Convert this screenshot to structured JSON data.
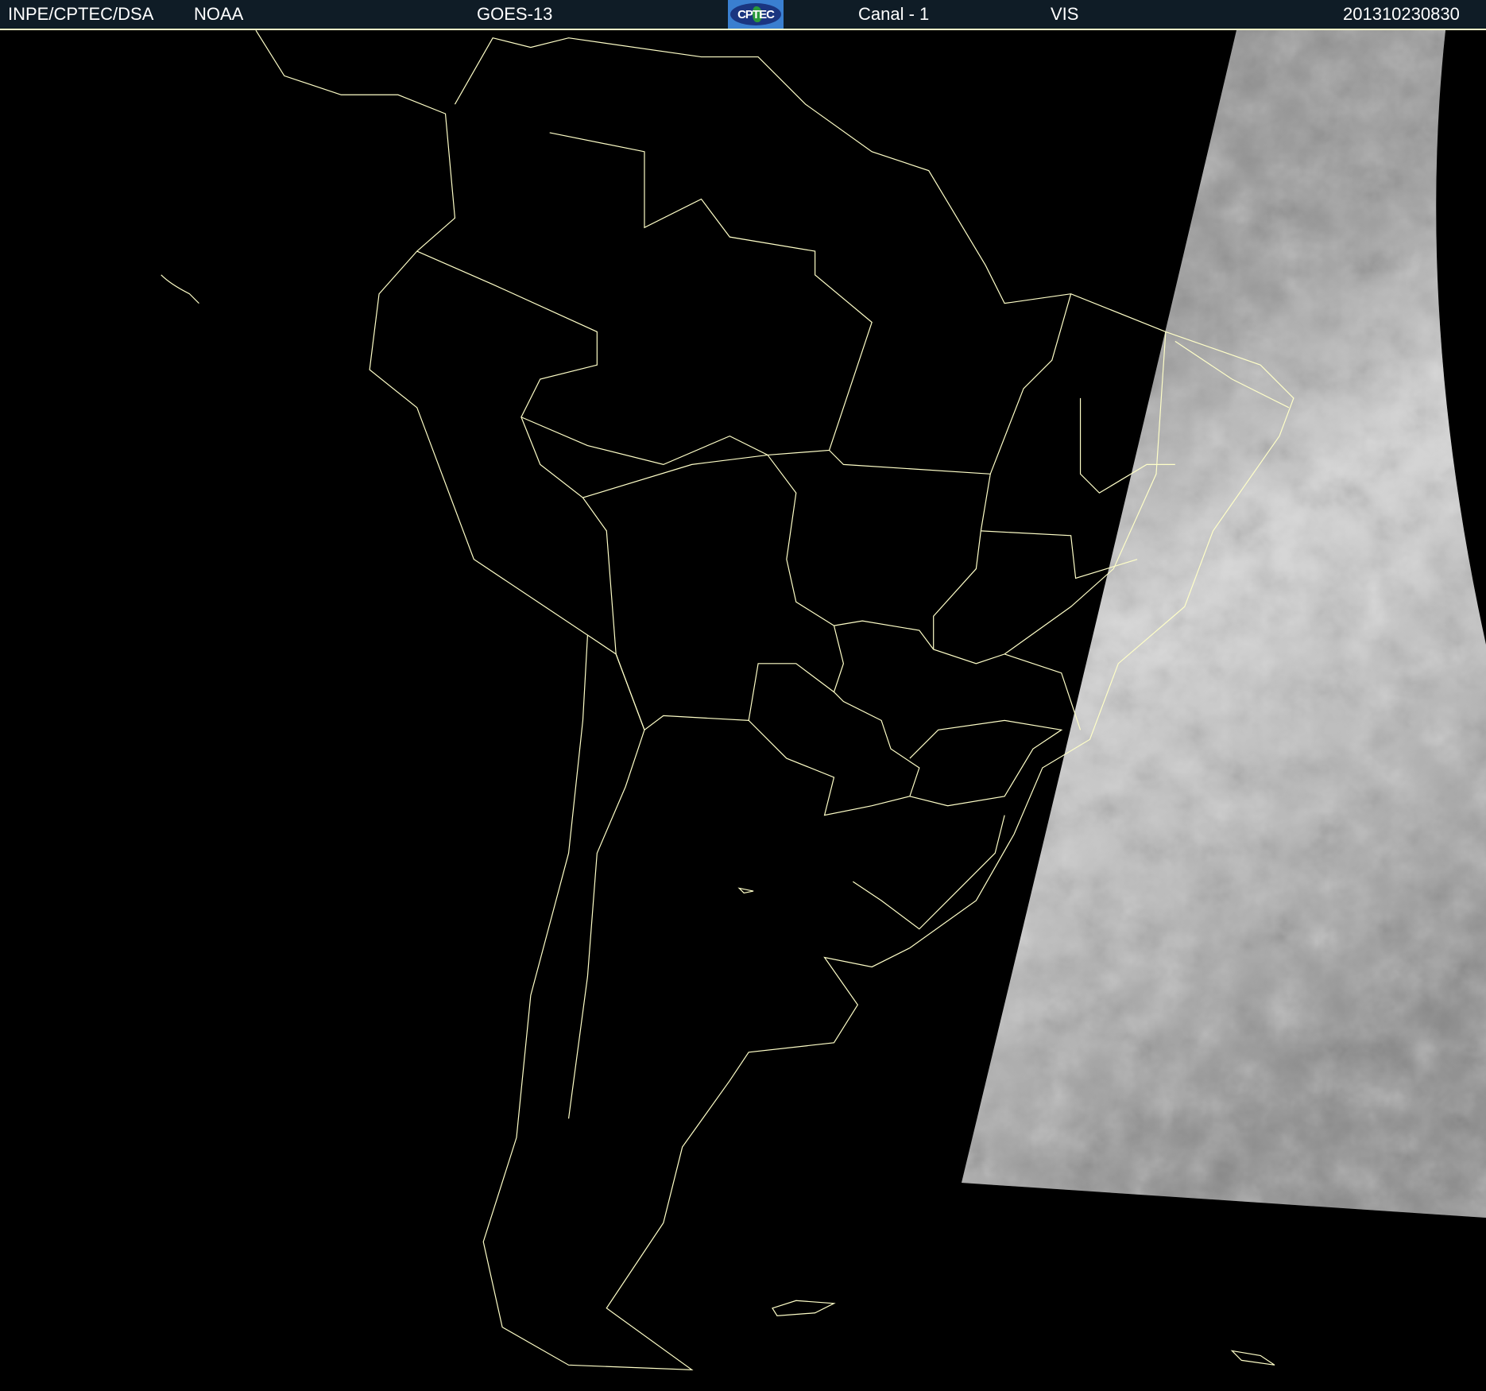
{
  "header": {
    "agency": "INPE/CPTEC/DSA",
    "partner": "NOAA",
    "satellite": "GOES-13",
    "logo_text": "CPTEC",
    "channel": "Canal - 1",
    "band": "VIS",
    "timestamp": "201310230830"
  },
  "colors": {
    "header_bg": "#0f1c26",
    "border_lines": "#ffffc8",
    "background": "#000000"
  }
}
